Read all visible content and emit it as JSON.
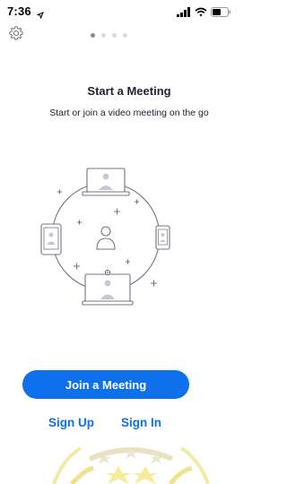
{
  "status_bar": {
    "time": "7:36",
    "icons": [
      "location-arrow-icon",
      "signal-bars-icon",
      "wifi-icon",
      "battery-icon"
    ]
  },
  "toolbar": {
    "settings_icon": "gear-icon"
  },
  "carousel": {
    "page_count": 4,
    "active_page": 1
  },
  "onboarding": {
    "title": "Start a Meeting",
    "subtitle": "Start or join a video meeting on the go",
    "illustration": "meeting-devices-illustration"
  },
  "actions": {
    "join_label": "Join a Meeting",
    "signup_label": "Sign Up",
    "signin_label": "Sign In"
  },
  "colors": {
    "accent": "#0E71EB",
    "text": "#222230",
    "illustration_stroke": "#747487",
    "watermark": "#F0E28A"
  }
}
